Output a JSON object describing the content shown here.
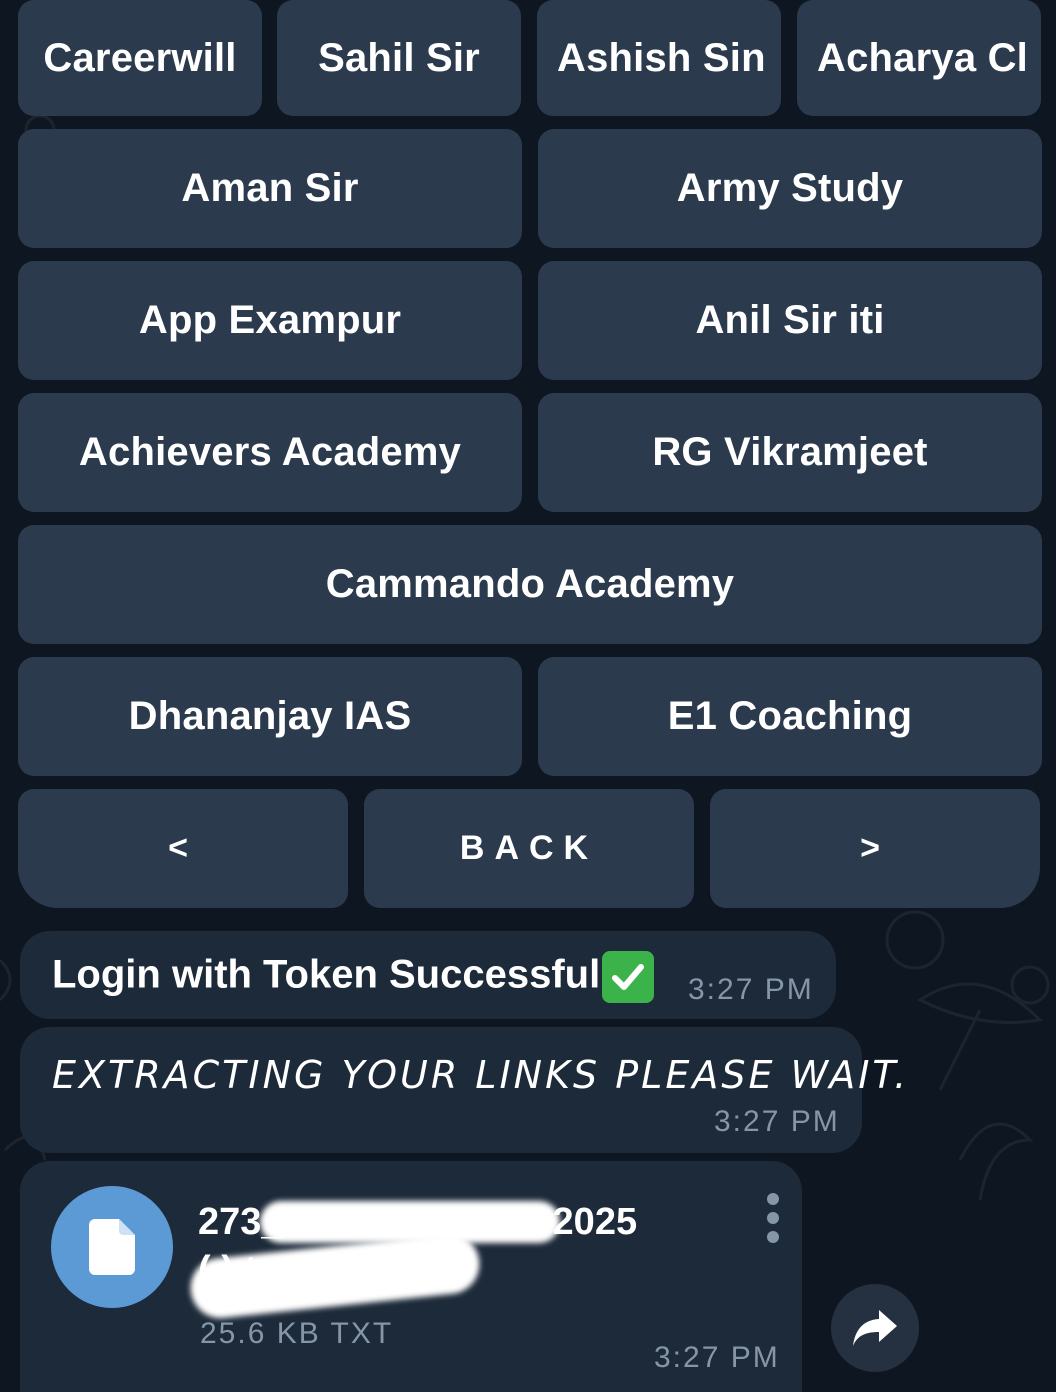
{
  "keyboard": {
    "rows": [
      [
        "Careerwill",
        "Sahil Sir",
        "Ashish Sin",
        "Acharya Cl"
      ],
      [
        "Aman Sir",
        "Army Study"
      ],
      [
        "App Exampur",
        "Anil Sir iti"
      ],
      [
        "Achievers Academy",
        "RG Vikramjeet"
      ],
      [
        "Cammando Academy"
      ],
      [
        "Dhananjay IAS",
        "E1 Coaching"
      ],
      [
        "<",
        "BACK",
        ">"
      ]
    ]
  },
  "messages": [
    {
      "text": "Login with Token Successful",
      "emoji": "check-mark-button",
      "time": "3:27 PM"
    },
    {
      "text": "EXTRACTING YOUR LINKS PLEASE WAIT.",
      "time": "3:27 PM"
    }
  ],
  "file": {
    "name_line1_start": "273_",
    "name_line1_end": "2025",
    "name_line2": "(          ).txt",
    "size": "25.6 KB TXT",
    "time": "3:27 PM"
  },
  "colors": {
    "background": "#0e1621",
    "button": "#2b3a4d",
    "bubble": "#1d2a39",
    "file_icon": "#5c9ad6",
    "check": "#3bb34a",
    "muted_text": "#8596a8"
  }
}
